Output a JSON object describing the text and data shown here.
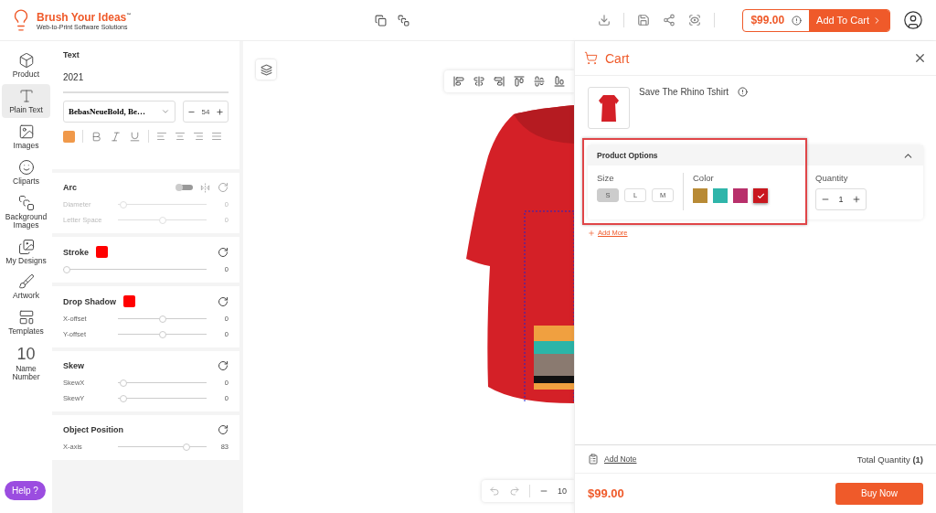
{
  "header": {
    "brand": "Brush Your Ideas",
    "trademark": "™",
    "tagline": "Web-to-Print Software Solutions",
    "price": "$99.00",
    "add_to_cart": "Add To Cart"
  },
  "nav": [
    {
      "label": "Product",
      "kind": "box",
      "selected": false
    },
    {
      "label": "Plain Text",
      "kind": "text",
      "selected": true
    },
    {
      "label": "Images",
      "kind": "image",
      "selected": false
    },
    {
      "label": "Cliparts",
      "kind": "smile",
      "selected": false
    },
    {
      "label": "Background Images",
      "kind": "layers",
      "selected": false
    },
    {
      "label": "My Designs",
      "kind": "designs",
      "selected": false
    },
    {
      "label": "Artwork",
      "kind": "brush",
      "selected": false
    },
    {
      "label": "Templates",
      "kind": "templates",
      "selected": false
    },
    {
      "label": "Name Number",
      "kind": "number",
      "glyph": "10",
      "selected": false
    }
  ],
  "help": "Help ?",
  "text_panel": {
    "title": "Text",
    "value": "2021",
    "font": "BebasNeueBold, Be…",
    "size": "54",
    "color": "#f0994a"
  },
  "sections": [
    {
      "title": "Arc",
      "toggle": {
        "on": false
      },
      "sliders": [
        {
          "label": "Diameter",
          "level": 0.02,
          "value": "0",
          "disabled": true
        },
        {
          "label": "Letter Space",
          "level": 0.5,
          "value": "0",
          "disabled": true
        }
      ]
    },
    {
      "title": "Stroke",
      "color": "#ff0000",
      "sliders": [
        {
          "level": 0.0,
          "value": "0",
          "disabled": false
        }
      ]
    },
    {
      "title": "Drop Shadow",
      "color": "#ff0000",
      "sliders": [
        {
          "label": "X-offset",
          "level": 0.5,
          "value": "0",
          "disabled": false
        },
        {
          "label": "Y-offset",
          "level": 0.5,
          "value": "0",
          "disabled": false
        }
      ]
    },
    {
      "title": "Skew",
      "sliders": [
        {
          "label": "SkewX",
          "level": 0.02,
          "value": "0",
          "disabled": false
        },
        {
          "label": "SkewY",
          "level": 0.02,
          "value": "0",
          "disabled": false
        }
      ]
    },
    {
      "title": "Object Position",
      "sliders": [
        {
          "label": "X-axis",
          "level": 0.8,
          "value": "83",
          "disabled": false
        }
      ]
    }
  ],
  "canvas": {
    "zoom": "10"
  },
  "cart": {
    "title": "Cart",
    "product": "Save The Rhino Tshirt",
    "options": {
      "title": "Product Options",
      "highlighted": true,
      "expanded": true,
      "size_label": "Size",
      "sizes": [
        {
          "label": "S",
          "selected": true
        },
        {
          "label": "L",
          "selected": false
        },
        {
          "label": "M",
          "selected": false
        }
      ],
      "color_label": "Color",
      "colors": [
        {
          "color": "#b88a35",
          "selected": false
        },
        {
          "color": "#2fb5aa",
          "selected": false
        },
        {
          "color": "#b8306b",
          "selected": false
        },
        {
          "color": "#c9181f",
          "selected": true
        }
      ],
      "quantity_label": "Quantity",
      "quantity": "1"
    },
    "add_more": "Add More",
    "add_note": "Add Note",
    "total": "Total Quantity **(1)**",
    "price": "$99.00",
    "buy": "Buy Now"
  }
}
